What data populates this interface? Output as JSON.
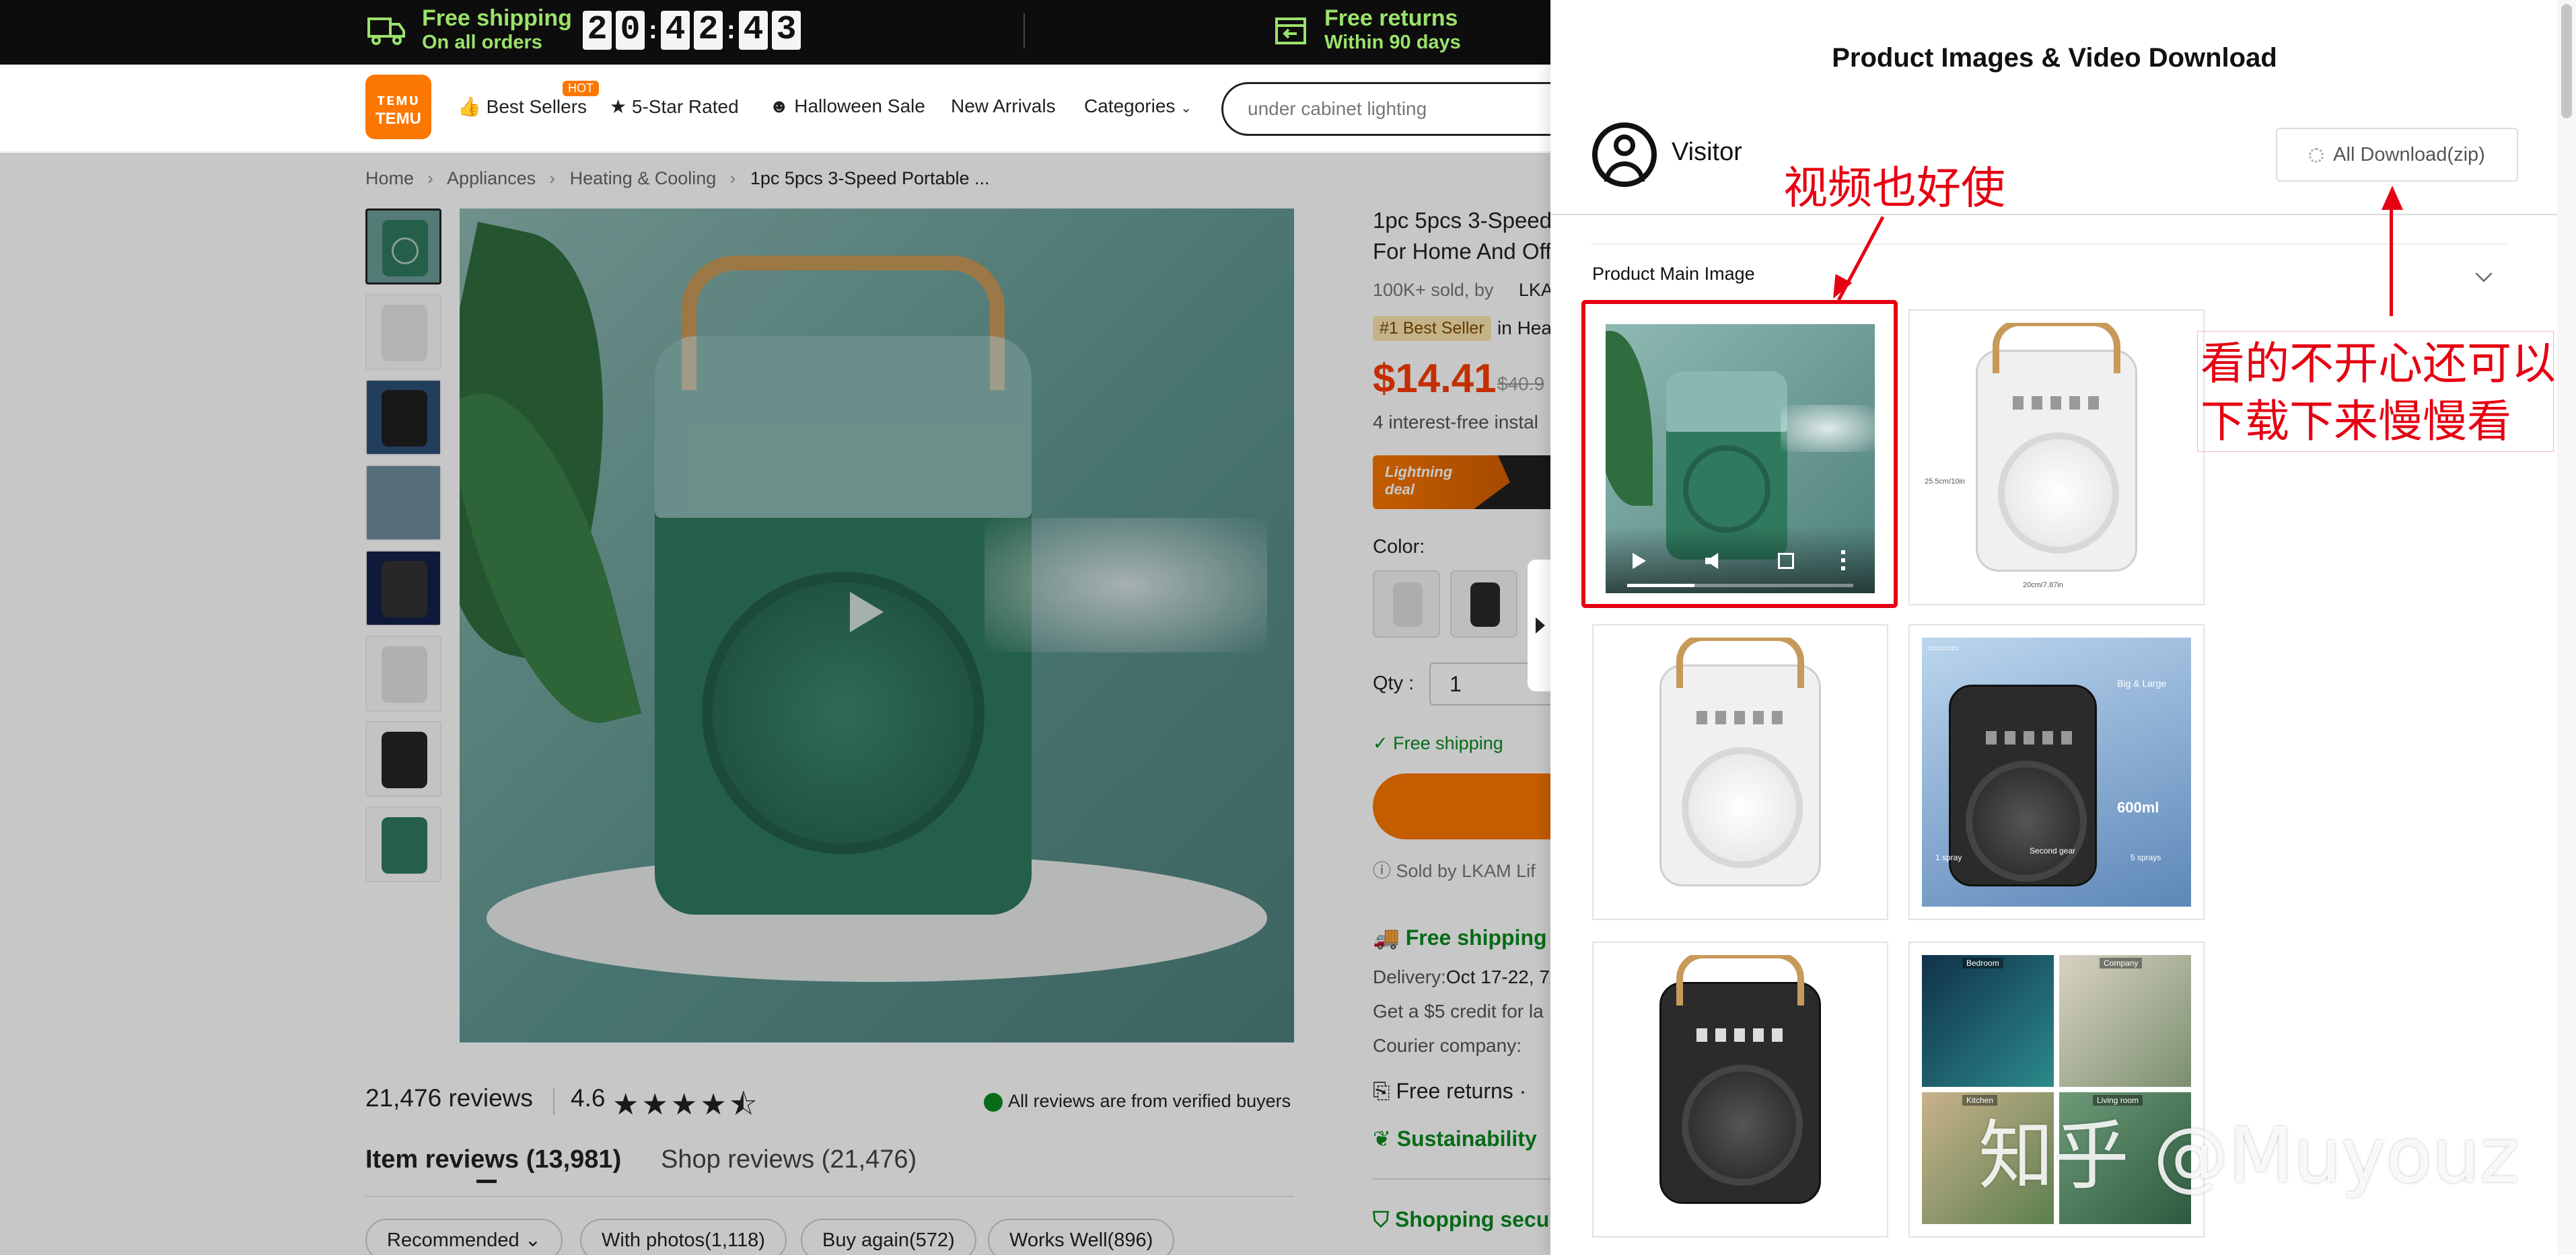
{
  "topbar": {
    "shipping_title": "Free shipping",
    "shipping_sub": "On all orders",
    "countdown_digits": [
      "2",
      "0",
      "4",
      "2",
      "4",
      "3"
    ],
    "returns_title": "Free returns",
    "returns_sub": "Within 90 days"
  },
  "header": {
    "logo_line1": "ᴛᴇᴍᴜ",
    "logo_line2": "TEMU",
    "hot_badge": "HOT",
    "nav": [
      "Best Sellers",
      "5-Star Rated",
      "Halloween Sale",
      "New Arrivals",
      "Categories"
    ],
    "search_value": "under cabinet lighting"
  },
  "breadcrumb": [
    "Home",
    "Appliances",
    "Heating & Cooling",
    "1pc 5pcs 3-Speed Portable ..."
  ],
  "product": {
    "title_line1": "1pc 5pcs 3-Speed",
    "title_line2": "For Home And Off",
    "sold": "100K+ sold, by",
    "seller_short": "LKA",
    "best_seller_badge": "#1 Best Seller",
    "badge_suffix": "in Hea",
    "price": "$14.41",
    "old_price": "$40.9",
    "installments": "4 interest-free instal",
    "lightning_label": "Lightning deal",
    "color_label": "Color:",
    "qty_label": "Qty :",
    "qty_value": "1",
    "free_shipping_small": "Free shipping",
    "sold_by": "Sold by LKAM Lif",
    "free_shipping": "Free shipping",
    "delivery_label": "Delivery:",
    "delivery_value": "Oct 17-22, 7",
    "credit": "Get a $5 credit for la",
    "courier": "Courier company:",
    "free_returns": "Free returns ·",
    "sustainability": "Sustainability",
    "shopping_security": "Shopping secu"
  },
  "reviews": {
    "count": "21,476 reviews",
    "rating": "4.6",
    "stars": "★★★★⯪",
    "verified": "All reviews are from verified buyers",
    "tab_item": "Item reviews (13,981)",
    "tab_shop": "Shop reviews (21,476)",
    "chips": [
      "Recommended ⌄",
      "With photos(1,118)",
      "Buy again(572)",
      "Works Well(896)"
    ]
  },
  "panel": {
    "title": "Product Images & Video Download",
    "user": "Visitor",
    "download_button": "All Download(zip)",
    "section_label": "Product Main Image",
    "dim_height": "25.5cm/10in",
    "dim_width": "20cm/7.87in",
    "feature_tag": "Big & Large",
    "feature_capacity": "600ml",
    "spray_1": "1 spray",
    "spray_2": "Second gear",
    "spray_3": "5 sprays",
    "collage_labels": [
      "Bedroom",
      "Company",
      "Kitchen",
      "Living room"
    ]
  },
  "annotations": {
    "video_note": "视频也好使",
    "download_note_1": "看的不开心还可以",
    "download_note_2": "下载下来慢慢看",
    "watermark": "知乎 @Muyouz"
  },
  "colors": {
    "accent_orange": "#fb7701",
    "price_red": "#fb3b00",
    "annotation_red": "#e60012",
    "promo_green": "#9be26c",
    "ok_green": "#0a8a1f"
  },
  "icons": [
    "truck-icon",
    "returns-icon",
    "thumbs-up-icon",
    "star-badge-icon",
    "pumpkin-icon",
    "chevron-down-icon",
    "play-icon",
    "user-icon",
    "spinner-icon",
    "check-icon",
    "info-icon",
    "shield-icon",
    "leaf-icon"
  ]
}
